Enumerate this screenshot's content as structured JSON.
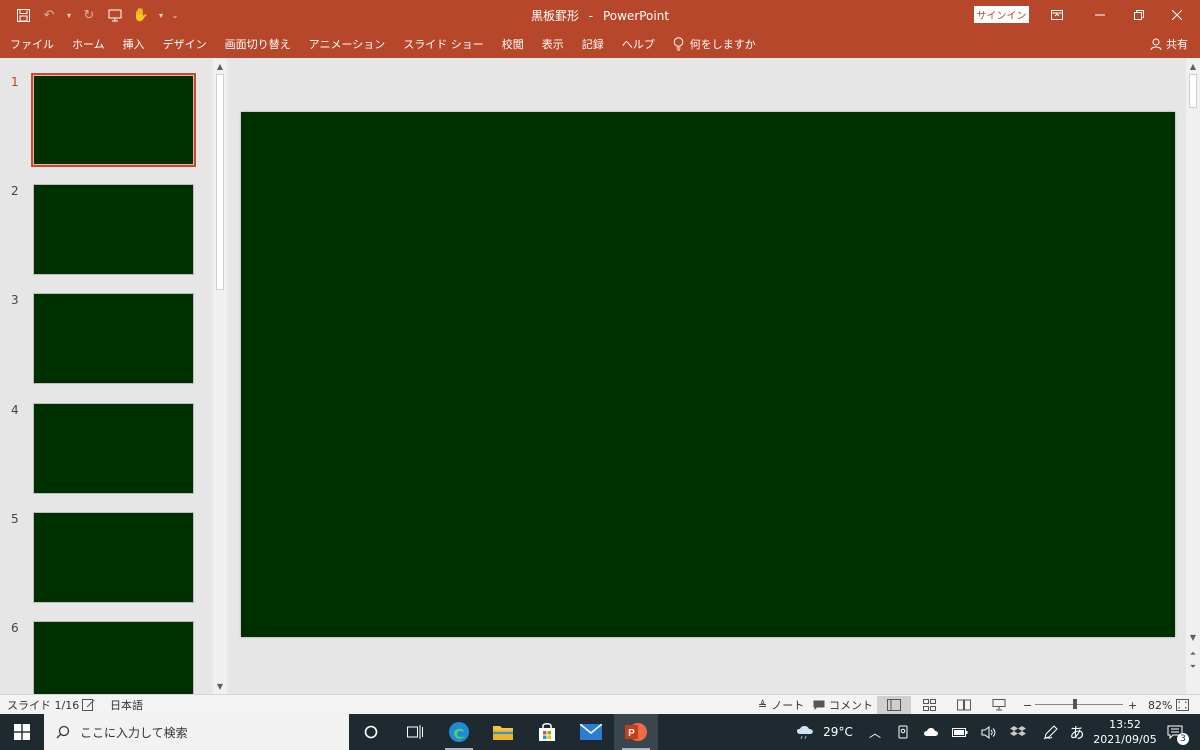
{
  "titlebar": {
    "doc_name": "黒板罫形",
    "separator": "-",
    "app_name": "PowerPoint",
    "signin_label": "サインイン"
  },
  "menu": {
    "items": [
      "ファイル",
      "ホーム",
      "挿入",
      "デザイン",
      "画面切り替え",
      "アニメーション",
      "スライド ショー",
      "校閲",
      "表示",
      "記録",
      "ヘルプ"
    ],
    "tell_me": "何をしますか",
    "share": "共有"
  },
  "slides": {
    "numbers": [
      "1",
      "2",
      "3",
      "4",
      "5",
      "6"
    ],
    "active_index": 0,
    "background_color": "#003000"
  },
  "status": {
    "slide_counter": "スライド 1/16",
    "language": "日本語",
    "notes_label": "ノート",
    "comments_label": "コメント",
    "zoom_minus": "−",
    "zoom_plus": "+",
    "zoom_level": "82%",
    "zoom_fraction": 0.45
  },
  "taskbar": {
    "search_placeholder": "ここに入力して検索",
    "temperature": "29°C",
    "ime": "あ",
    "time": "13:52",
    "date": "2021/09/05",
    "notification_count": "3"
  },
  "colors": {
    "accent": "#b7472a",
    "slide_bg": "#003000",
    "taskbar_bg": "#1f2a30"
  }
}
